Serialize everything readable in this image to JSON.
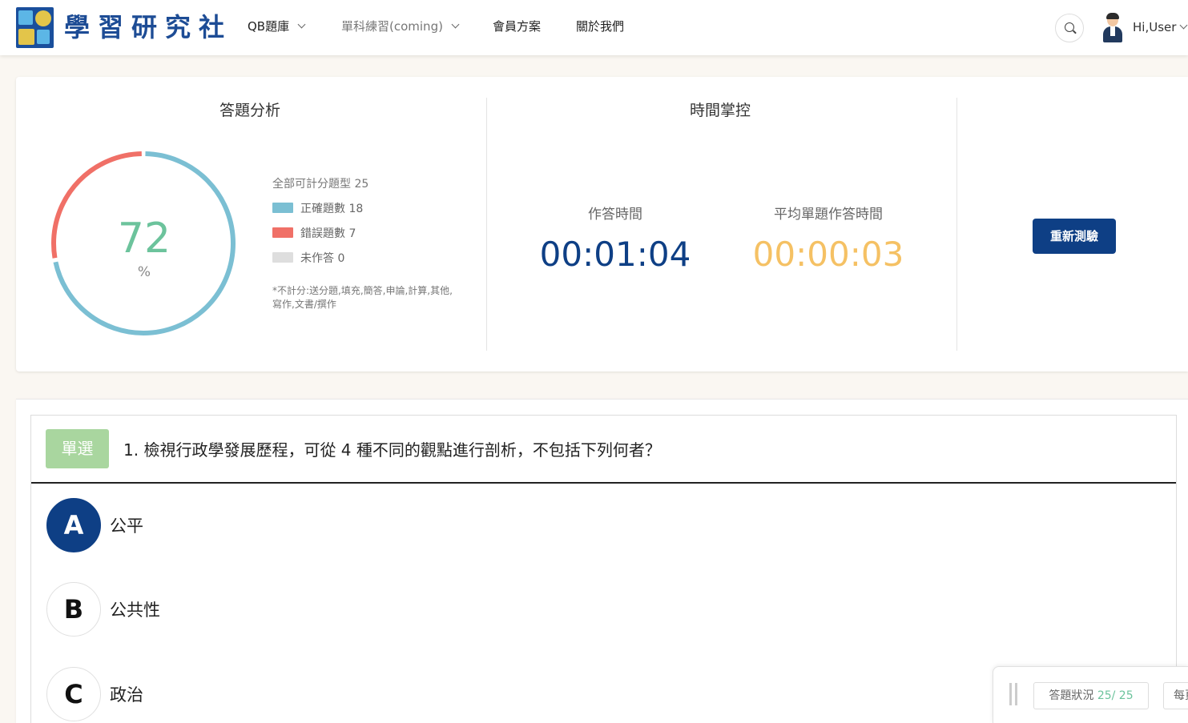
{
  "header": {
    "logo_text": "學習研究社",
    "nav": [
      {
        "label": "QB題庫",
        "has_dropdown": true
      },
      {
        "label": "單科練習(coming)",
        "has_dropdown": true
      },
      {
        "label": "會員方案",
        "has_dropdown": false
      },
      {
        "label": "關於我們",
        "has_dropdown": false
      }
    ],
    "user_label": "Hi,User"
  },
  "analysis": {
    "title": "答題分析",
    "percent": "72",
    "percent_unit": "%",
    "correct_fraction": 0.72,
    "total_label": "全部可計分題型 25",
    "legend": [
      {
        "label": "正確題數 18",
        "color": "#7bbfd3"
      },
      {
        "label": "錯誤題數 7",
        "color": "#f07067"
      },
      {
        "label": "未作答 0",
        "color": "#dedede"
      }
    ],
    "note": "*不計分:送分題,填充,簡答,申論,計算,其他,寫作,文書/撰作"
  },
  "timing": {
    "title": "時間掌控",
    "answer_time_label": "作答時間",
    "answer_time": "00:01:04",
    "avg_time_label": "平均單題作答時間",
    "avg_time": "00:00:03",
    "answer_color": "#0e3f85",
    "avg_color": "#f5c164"
  },
  "retest_label": "重新測驗",
  "question": {
    "type_badge": "單選",
    "text": "1. 檢視行政學發展歷程，可從 4 種不同的觀點進行剖析，不包括下列何者？",
    "options": [
      {
        "letter": "A",
        "text": "公平",
        "selected": true
      },
      {
        "letter": "B",
        "text": "公共性",
        "selected": false
      },
      {
        "letter": "C",
        "text": "政治",
        "selected": false
      }
    ]
  },
  "status_bar": {
    "label": "答題狀況",
    "count": "25/ 25",
    "more_label": "每頁"
  }
}
